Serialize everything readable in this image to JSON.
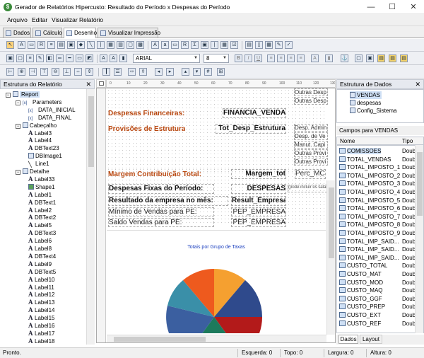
{
  "window": {
    "title": "Gerador de Relatórios Hipercusto: Resultado do Período x Despesas do Período",
    "minimize": "—",
    "maximize": "☐",
    "close": "✕"
  },
  "menu": [
    "Arquivo",
    "Editar",
    "Visualizar",
    "Relatório"
  ],
  "tabs": [
    "Dados",
    "Cálculo",
    "Desenho",
    "Visualizar Impressão"
  ],
  "toolbar": {
    "font_name": "ARIAL",
    "font_size": "8",
    "bold": "B",
    "italic": "I",
    "underline": "U"
  },
  "left_panel": {
    "title": "Estrutura do Relatório",
    "close": "✕",
    "tree": [
      {
        "label": "Report",
        "depth": 0,
        "icon": "report",
        "selected": true
      },
      {
        "label": "Parameters",
        "depth": 1,
        "icon": "param"
      },
      {
        "label": "DATA_INICIAL",
        "depth": 2,
        "icon": "param"
      },
      {
        "label": "DATA_FINAL",
        "depth": 2,
        "icon": "param"
      },
      {
        "label": "Cabeçalho",
        "depth": 1,
        "icon": "band"
      },
      {
        "label": "Label3",
        "depth": 2,
        "icon": "label"
      },
      {
        "label": "Label4",
        "depth": 2,
        "icon": "label"
      },
      {
        "label": "DBText23",
        "depth": 2,
        "icon": "dbtext"
      },
      {
        "label": "DBImage1",
        "depth": 2,
        "icon": "image"
      },
      {
        "label": "Line1",
        "depth": 2,
        "icon": "line"
      },
      {
        "label": "Detalhe",
        "depth": 1,
        "icon": "band"
      },
      {
        "label": "Label33",
        "depth": 2,
        "icon": "label"
      },
      {
        "label": "Shape1",
        "depth": 2,
        "icon": "shape"
      },
      {
        "label": "Label1",
        "depth": 2,
        "icon": "label"
      },
      {
        "label": "DBText1",
        "depth": 2,
        "icon": "dbtext"
      },
      {
        "label": "Label2",
        "depth": 2,
        "icon": "label"
      },
      {
        "label": "DBText2",
        "depth": 2,
        "icon": "dbtext"
      },
      {
        "label": "Label5",
        "depth": 2,
        "icon": "label"
      },
      {
        "label": "DBText3",
        "depth": 2,
        "icon": "dbtext"
      },
      {
        "label": "Label6",
        "depth": 2,
        "icon": "label"
      },
      {
        "label": "Label8",
        "depth": 2,
        "icon": "label"
      },
      {
        "label": "DBText4",
        "depth": 2,
        "icon": "dbtext"
      },
      {
        "label": "Label9",
        "depth": 2,
        "icon": "label"
      },
      {
        "label": "DBText5",
        "depth": 2,
        "icon": "dbtext"
      },
      {
        "label": "Label10",
        "depth": 2,
        "icon": "label"
      },
      {
        "label": "Label11",
        "depth": 2,
        "icon": "label"
      },
      {
        "label": "Label12",
        "depth": 2,
        "icon": "label"
      },
      {
        "label": "Label13",
        "depth": 2,
        "icon": "label"
      },
      {
        "label": "Label14",
        "depth": 2,
        "icon": "label"
      },
      {
        "label": "Label15",
        "depth": 2,
        "icon": "label"
      },
      {
        "label": "Label16",
        "depth": 2,
        "icon": "label"
      },
      {
        "label": "Label17",
        "depth": 2,
        "icon": "label"
      },
      {
        "label": "Label18",
        "depth": 2,
        "icon": "label"
      }
    ]
  },
  "designer": {
    "ruler_top": [
      "0",
      "10",
      "20",
      "30",
      "40",
      "50",
      "60",
      "70",
      "80",
      "90",
      "100",
      "110",
      "120",
      "130"
    ],
    "top_right_fields": [
      "Outras Desp",
      "Outras Desp"
    ],
    "row1_label": "Despesas Financeiras:",
    "row1_field": "FINANCIA_VENDA",
    "row2_label": "Provisões de Estrutura",
    "row2_field": "Tot_Desp_Estrutura",
    "right_list": [
      "Desp. Admin",
      "Desp. de Ve",
      "Manut. Capi",
      "Outras Provi",
      "Outras Provi"
    ],
    "row3_label": "Margem Contribuição Total:",
    "row3_field": "Margem_tot",
    "row3_extra": "Perc_MC",
    "row4_label": "Despesas Fixas do Período:",
    "row4_field": "DESPESAS",
    "row4_note": "(pode incluir os salár",
    "row5_label": "Resultado da empresa no mês:",
    "row5_field": "Result_Empresa",
    "row6_label": "Mínimo de Vendas para PE:",
    "row6_field": "PEP_EMPRESA",
    "row7_label": "Saldo Vendas para PE:",
    "row7_field": "PEP_EMPRESA",
    "chart_title": "Totais por Grupo de Taxas"
  },
  "right_panel": {
    "title": "Estrutura de Dados",
    "close": "✕",
    "datasets": [
      "VENDAS",
      "despesas",
      "Config_Sistema"
    ],
    "fields_title": "Campos para VENDAS",
    "col_name": "Nome",
    "col_type": "Tipo",
    "fields": [
      {
        "name": "COMISSOES",
        "type": "Doub"
      },
      {
        "name": "TOTAL_VENDAS",
        "type": "Doub"
      },
      {
        "name": "TOTAL_IMPOSTO_1",
        "type": "Doub"
      },
      {
        "name": "TOTAL_IMPOSTO_2",
        "type": "Doub"
      },
      {
        "name": "TOTAL_IMPOSTO_3",
        "type": "Doub"
      },
      {
        "name": "TOTAL_IMPOSTO_4",
        "type": "Doub"
      },
      {
        "name": "TOTAL_IMPOSTO_5",
        "type": "Doub"
      },
      {
        "name": "TOTAL_IMPOSTO_6",
        "type": "Doub"
      },
      {
        "name": "TOTAL_IMPOSTO_7",
        "type": "Doub"
      },
      {
        "name": "TOTAL_IMPOSTO_8",
        "type": "Doub"
      },
      {
        "name": "TOTAL_IMPOSTO_9",
        "type": "Doub"
      },
      {
        "name": "TOTAL_IMP_SAID...",
        "type": "Doub"
      },
      {
        "name": "TOTAL_IMP_SAID...",
        "type": "Doub"
      },
      {
        "name": "TOTAL_IMP_SAID...",
        "type": "Doub"
      },
      {
        "name": "CUSTO_TOTAL",
        "type": "Doub"
      },
      {
        "name": "CUSTO_MAT",
        "type": "Doub"
      },
      {
        "name": "CUSTO_MOD",
        "type": "Doub"
      },
      {
        "name": "CUSTO_MAQ",
        "type": "Doub"
      },
      {
        "name": "CUSTO_GGF",
        "type": "Doub"
      },
      {
        "name": "CUSTO_PREP",
        "type": "Doub"
      },
      {
        "name": "CUSTO_EXT",
        "type": "Doub"
      },
      {
        "name": "CUSTO_REF",
        "type": "Doub"
      }
    ],
    "bottom_tabs": [
      "Dados",
      "Layout"
    ]
  },
  "status": {
    "text": "Pronto.",
    "left": "Esquerda: 0",
    "top": "Topo: 0",
    "width": "Largura: 0",
    "height": "Altura: 0"
  }
}
